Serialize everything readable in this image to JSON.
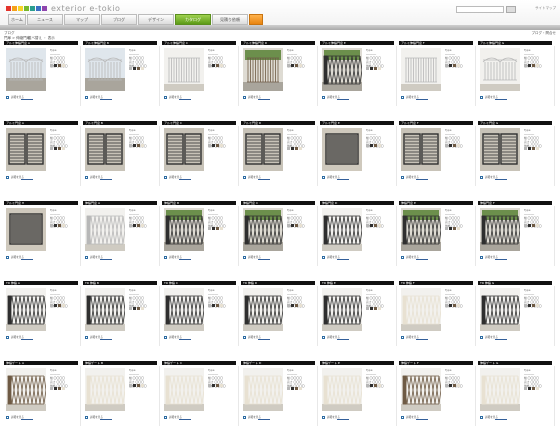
{
  "header": {
    "logo_text": "exterior e-tokio",
    "logo_colors": [
      "#e3332b",
      "#f5a018",
      "#f7d325",
      "#76b82a",
      "#2a9d8f",
      "#3a6fc4",
      "#8e44ad"
    ],
    "util_text": "サイトマップ",
    "nav": [
      {
        "label": "ホーム",
        "style": "home"
      },
      {
        "label": "ニュース",
        "style": "normal"
      },
      {
        "label": "マップ",
        "style": "normal"
      },
      {
        "label": "ブログ",
        "style": "normal"
      },
      {
        "label": "デザイン",
        "style": "normal"
      },
      {
        "label": "カタログ",
        "style": "sel"
      },
      {
        "label": "見積り依頼",
        "style": "normal"
      },
      {
        "label": "",
        "style": "orange"
      }
    ],
    "sub_left": "ブログ",
    "sub_right": "ブログ・問合せ"
  },
  "toolbar": {
    "breadcrumb": "門扉 > 伸縮門扉",
    "filters": "並べ替え ・ 表示"
  },
  "card_text": {
    "spec": "Type\n──────\n幅 〇〇〇〇\n高さ 〇〇〇\n価格 〇〇〇〇",
    "link": "詳細を見る",
    "compare": "比較"
  },
  "gate_colors": {
    "silver": "#b7b7b7",
    "dark": "#2f2f2f",
    "bronze": "#6e5a44",
    "ivory": "#e8e1d2",
    "ground": "#a9a59c",
    "wall": "#dedbd3",
    "green": "#6c8f4c",
    "sky": "#dfe6ec"
  },
  "cards": [
    {
      "title": "アルミ伸縮門扉 A",
      "gate": "grille",
      "color": "silver",
      "bg": "outdoor"
    },
    {
      "title": "アルミ伸縮門扉 B",
      "gate": "grille",
      "color": "silver",
      "bg": "outdoor"
    },
    {
      "title": "アルミ伸縮門扉 C",
      "gate": "vbars",
      "color": "silver",
      "bg": "plain"
    },
    {
      "title": "アルミ伸縮門扉 D",
      "gate": "vbars",
      "color": "bronze",
      "bg": "garden"
    },
    {
      "title": "アルミ伸縮門扉 E",
      "gate": "lattice",
      "color": "dark",
      "bg": "garden"
    },
    {
      "title": "アルミ伸縮門扉 F",
      "gate": "vbars",
      "color": "silver",
      "bg": "plain"
    },
    {
      "title": "アルミ伸縮門扉 G",
      "gate": "grille",
      "color": "silver",
      "bg": "plain"
    },
    {
      "title": "アルミ門扉 A",
      "gate": "panel",
      "color": "dark",
      "bg": "plain"
    },
    {
      "title": "アルミ門扉 B",
      "gate": "panel",
      "color": "dark",
      "bg": "plain"
    },
    {
      "title": "アルミ門扉 C",
      "gate": "panel",
      "color": "dark",
      "bg": "plain"
    },
    {
      "title": "アルミ門扉 D",
      "gate": "panel",
      "color": "dark",
      "bg": "plain"
    },
    {
      "title": "アルミ門扉 E",
      "gate": "slats",
      "color": "dark",
      "bg": "plain"
    },
    {
      "title": "アルミ門扉 F",
      "gate": "panel",
      "color": "dark",
      "bg": "plain"
    },
    {
      "title": "アルミ門扉 G",
      "gate": "panel",
      "color": "dark",
      "bg": "plain"
    },
    {
      "title": "アルミ門扉 H",
      "gate": "slats",
      "color": "dark",
      "bg": "plain"
    },
    {
      "title": "伸縮門扉 A",
      "gate": "lattice",
      "color": "silver",
      "bg": "plain"
    },
    {
      "title": "伸縮門扉 B",
      "gate": "lattice",
      "color": "dark",
      "bg": "garden"
    },
    {
      "title": "伸縮門扉 C",
      "gate": "lattice",
      "color": "dark",
      "bg": "garden"
    },
    {
      "title": "伸縮門扉 D",
      "gate": "lattice",
      "color": "dark",
      "bg": "plain"
    },
    {
      "title": "伸縮門扉 E",
      "gate": "lattice",
      "color": "dark",
      "bg": "garden"
    },
    {
      "title": "伸縮門扉 F",
      "gate": "lattice",
      "color": "dark",
      "bg": "garden"
    },
    {
      "title": "TR 伸縮 A",
      "gate": "lattice",
      "color": "dark",
      "bg": "plain"
    },
    {
      "title": "TR 伸縮 B",
      "gate": "lattice",
      "color": "dark",
      "bg": "plain"
    },
    {
      "title": "TR 伸縮 C",
      "gate": "lattice",
      "color": "dark",
      "bg": "plain"
    },
    {
      "title": "TR 伸縮 D",
      "gate": "lattice",
      "color": "dark",
      "bg": "plain"
    },
    {
      "title": "TR 伸縮 E",
      "gate": "lattice",
      "color": "dark",
      "bg": "plain"
    },
    {
      "title": "TR 伸縮 F",
      "gate": "lattice",
      "color": "ivory",
      "bg": "plain"
    },
    {
      "title": "TR 伸縮 G",
      "gate": "lattice",
      "color": "dark",
      "bg": "plain"
    },
    {
      "title": "伸縮ゲート A",
      "gate": "lattice",
      "color": "bronze",
      "bg": "plain"
    },
    {
      "title": "伸縮ゲート B",
      "gate": "lattice",
      "color": "ivory",
      "bg": "plain"
    },
    {
      "title": "伸縮ゲート C",
      "gate": "lattice",
      "color": "ivory",
      "bg": "plain"
    },
    {
      "title": "伸縮ゲート D",
      "gate": "lattice",
      "color": "ivory",
      "bg": "plain"
    },
    {
      "title": "伸縮ゲート E",
      "gate": "lattice",
      "color": "ivory",
      "bg": "plain"
    },
    {
      "title": "伸縮ゲート F",
      "gate": "lattice",
      "color": "bronze",
      "bg": "plain"
    },
    {
      "title": "伸縮ゲート G",
      "gate": "lattice",
      "color": "ivory",
      "bg": "plain"
    }
  ]
}
